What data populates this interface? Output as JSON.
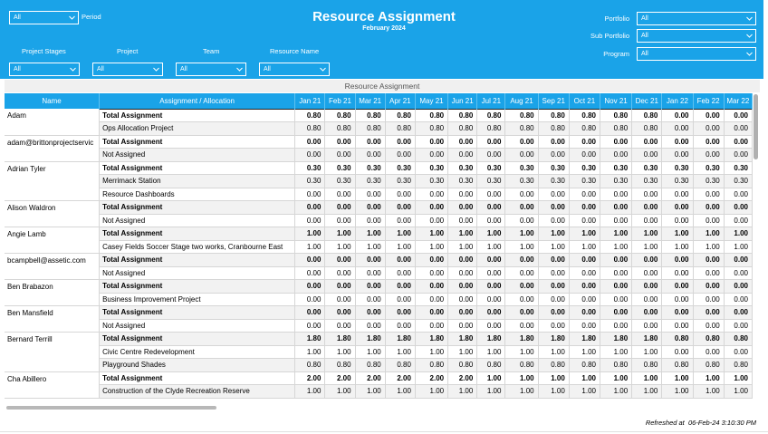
{
  "header": {
    "title": "Resource Assignment",
    "subtitle": "February 2024",
    "period": {
      "value": "All",
      "label": "Period"
    },
    "filters": [
      {
        "label": "Project Stages",
        "value": "All"
      },
      {
        "label": "Project",
        "value": "All"
      },
      {
        "label": "Team",
        "value": "All"
      },
      {
        "label": "Resource Name",
        "value": "All"
      }
    ],
    "right_filters": [
      {
        "label": "Portfolio",
        "value": "All"
      },
      {
        "label": "Sub Portfolio",
        "value": "All"
      },
      {
        "label": "Program",
        "value": "All"
      }
    ]
  },
  "table": {
    "caption": "Resource Assignment",
    "col_name": "Name",
    "col_alloc": "Assignment / Allocation",
    "months": [
      "Jan 21",
      "Feb 21",
      "Mar 21",
      "Apr 21",
      "May 21",
      "Jun 21",
      "Jul 21",
      "Aug 21",
      "Sep 21",
      "Oct 21",
      "Nov 21",
      "Dec 21",
      "Jan 22",
      "Feb 22",
      "Mar 22"
    ],
    "groups": [
      {
        "name": "Adam",
        "rows": [
          {
            "label": "Total Assignment",
            "total": true,
            "values": [
              "0.80",
              "0.80",
              "0.80",
              "0.80",
              "0.80",
              "0.80",
              "0.80",
              "0.80",
              "0.80",
              "0.80",
              "0.80",
              "0.80",
              "0.00",
              "0.00",
              "0.00"
            ]
          },
          {
            "label": "Ops Allocation Project",
            "values": [
              "0.80",
              "0.80",
              "0.80",
              "0.80",
              "0.80",
              "0.80",
              "0.80",
              "0.80",
              "0.80",
              "0.80",
              "0.80",
              "0.80",
              "0.00",
              "0.00",
              "0.00"
            ]
          }
        ]
      },
      {
        "name": "adam@brittonprojectservic",
        "rows": [
          {
            "label": "Total Assignment",
            "total": true,
            "values": [
              "0.00",
              "0.00",
              "0.00",
              "0.00",
              "0.00",
              "0.00",
              "0.00",
              "0.00",
              "0.00",
              "0.00",
              "0.00",
              "0.00",
              "0.00",
              "0.00",
              "0.00"
            ]
          },
          {
            "label": "Not Assigned",
            "values": [
              "0.00",
              "0.00",
              "0.00",
              "0.00",
              "0.00",
              "0.00",
              "0.00",
              "0.00",
              "0.00",
              "0.00",
              "0.00",
              "0.00",
              "0.00",
              "0.00",
              "0.00"
            ]
          }
        ]
      },
      {
        "name": "Adrian Tyler",
        "rows": [
          {
            "label": "Total Assignment",
            "total": true,
            "values": [
              "0.30",
              "0.30",
              "0.30",
              "0.30",
              "0.30",
              "0.30",
              "0.30",
              "0.30",
              "0.30",
              "0.30",
              "0.30",
              "0.30",
              "0.30",
              "0.30",
              "0.30"
            ]
          },
          {
            "label": "Merrimack Station",
            "values": [
              "0.30",
              "0.30",
              "0.30",
              "0.30",
              "0.30",
              "0.30",
              "0.30",
              "0.30",
              "0.30",
              "0.30",
              "0.30",
              "0.30",
              "0.30",
              "0.30",
              "0.30"
            ]
          },
          {
            "label": "Resource Dashboards",
            "values": [
              "0.00",
              "0.00",
              "0.00",
              "0.00",
              "0.00",
              "0.00",
              "0.00",
              "0.00",
              "0.00",
              "0.00",
              "0.00",
              "0.00",
              "0.00",
              "0.00",
              "0.00"
            ]
          }
        ]
      },
      {
        "name": "Alison Waldron",
        "rows": [
          {
            "label": "Total Assignment",
            "total": true,
            "values": [
              "0.00",
              "0.00",
              "0.00",
              "0.00",
              "0.00",
              "0.00",
              "0.00",
              "0.00",
              "0.00",
              "0.00",
              "0.00",
              "0.00",
              "0.00",
              "0.00",
              "0.00"
            ]
          },
          {
            "label": "Not Assigned",
            "values": [
              "0.00",
              "0.00",
              "0.00",
              "0.00",
              "0.00",
              "0.00",
              "0.00",
              "0.00",
              "0.00",
              "0.00",
              "0.00",
              "0.00",
              "0.00",
              "0.00",
              "0.00"
            ]
          }
        ]
      },
      {
        "name": "Angie Lamb",
        "rows": [
          {
            "label": "Total Assignment",
            "total": true,
            "values": [
              "1.00",
              "1.00",
              "1.00",
              "1.00",
              "1.00",
              "1.00",
              "1.00",
              "1.00",
              "1.00",
              "1.00",
              "1.00",
              "1.00",
              "1.00",
              "1.00",
              "1.00"
            ]
          },
          {
            "label": "Casey Fields Soccer Stage two works, Cranbourne East",
            "values": [
              "1.00",
              "1.00",
              "1.00",
              "1.00",
              "1.00",
              "1.00",
              "1.00",
              "1.00",
              "1.00",
              "1.00",
              "1.00",
              "1.00",
              "1.00",
              "1.00",
              "1.00"
            ]
          }
        ]
      },
      {
        "name": "bcampbell@assetic.com",
        "rows": [
          {
            "label": "Total Assignment",
            "total": true,
            "values": [
              "0.00",
              "0.00",
              "0.00",
              "0.00",
              "0.00",
              "0.00",
              "0.00",
              "0.00",
              "0.00",
              "0.00",
              "0.00",
              "0.00",
              "0.00",
              "0.00",
              "0.00"
            ]
          },
          {
            "label": "Not Assigned",
            "values": [
              "0.00",
              "0.00",
              "0.00",
              "0.00",
              "0.00",
              "0.00",
              "0.00",
              "0.00",
              "0.00",
              "0.00",
              "0.00",
              "0.00",
              "0.00",
              "0.00",
              "0.00"
            ]
          }
        ]
      },
      {
        "name": "Ben Brabazon",
        "rows": [
          {
            "label": "Total Assignment",
            "total": true,
            "values": [
              "0.00",
              "0.00",
              "0.00",
              "0.00",
              "0.00",
              "0.00",
              "0.00",
              "0.00",
              "0.00",
              "0.00",
              "0.00",
              "0.00",
              "0.00",
              "0.00",
              "0.00"
            ]
          },
          {
            "label": "Business Improvement Project",
            "values": [
              "0.00",
              "0.00",
              "0.00",
              "0.00",
              "0.00",
              "0.00",
              "0.00",
              "0.00",
              "0.00",
              "0.00",
              "0.00",
              "0.00",
              "0.00",
              "0.00",
              "0.00"
            ]
          }
        ]
      },
      {
        "name": "Ben Mansfield",
        "rows": [
          {
            "label": "Total Assignment",
            "total": true,
            "values": [
              "0.00",
              "0.00",
              "0.00",
              "0.00",
              "0.00",
              "0.00",
              "0.00",
              "0.00",
              "0.00",
              "0.00",
              "0.00",
              "0.00",
              "0.00",
              "0.00",
              "0.00"
            ]
          },
          {
            "label": "Not Assigned",
            "values": [
              "0.00",
              "0.00",
              "0.00",
              "0.00",
              "0.00",
              "0.00",
              "0.00",
              "0.00",
              "0.00",
              "0.00",
              "0.00",
              "0.00",
              "0.00",
              "0.00",
              "0.00"
            ]
          }
        ]
      },
      {
        "name": "Bernard Terrill",
        "rows": [
          {
            "label": "Total Assignment",
            "total": true,
            "values": [
              "1.80",
              "1.80",
              "1.80",
              "1.80",
              "1.80",
              "1.80",
              "1.80",
              "1.80",
              "1.80",
              "1.80",
              "1.80",
              "1.80",
              "0.80",
              "0.80",
              "0.80"
            ]
          },
          {
            "label": "Civic Centre Redevelopment",
            "values": [
              "1.00",
              "1.00",
              "1.00",
              "1.00",
              "1.00",
              "1.00",
              "1.00",
              "1.00",
              "1.00",
              "1.00",
              "1.00",
              "1.00",
              "0.00",
              "0.00",
              "0.00"
            ]
          },
          {
            "label": "Playground Shades",
            "values": [
              "0.80",
              "0.80",
              "0.80",
              "0.80",
              "0.80",
              "0.80",
              "0.80",
              "0.80",
              "0.80",
              "0.80",
              "0.80",
              "0.80",
              "0.80",
              "0.80",
              "0.80"
            ]
          }
        ]
      },
      {
        "name": "Cha Abillero",
        "rows": [
          {
            "label": "Total Assignment",
            "total": true,
            "values": [
              "2.00",
              "2.00",
              "2.00",
              "2.00",
              "2.00",
              "2.00",
              "1.00",
              "1.00",
              "1.00",
              "1.00",
              "1.00",
              "1.00",
              "1.00",
              "1.00",
              "1.00"
            ]
          },
          {
            "label": "Construction of the Clyde Recreation Reserve",
            "values": [
              "1.00",
              "1.00",
              "1.00",
              "1.00",
              "1.00",
              "1.00",
              "1.00",
              "1.00",
              "1.00",
              "1.00",
              "1.00",
              "1.00",
              "1.00",
              "1.00",
              "1.00"
            ]
          }
        ]
      }
    ]
  },
  "footer": {
    "refreshed_label": "Refreshed at",
    "refreshed_value": "06-Feb-24 3:10:30 PM"
  },
  "colors": {
    "header_bg": "#1aa3e8",
    "text_white": "#ffffff"
  }
}
